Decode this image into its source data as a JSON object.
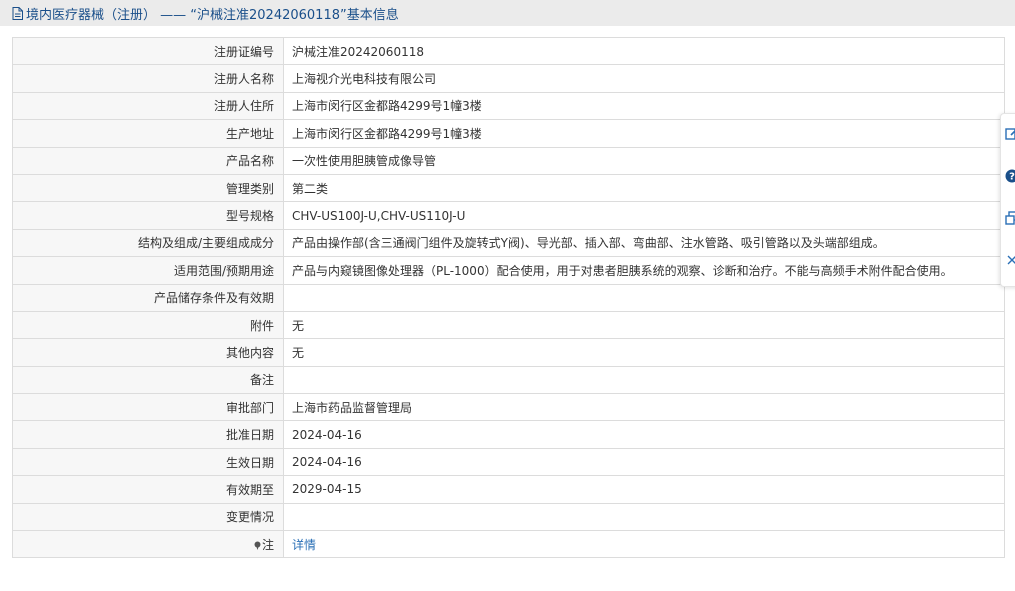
{
  "header": {
    "title": "境内医疗器械（注册） —— “沪械注准20242060118”基本信息",
    "icon": "document-icon"
  },
  "rows": [
    {
      "label": "注册证编号",
      "value": "沪械注准20242060118"
    },
    {
      "label": "注册人名称",
      "value": "上海视介光电科技有限公司"
    },
    {
      "label": "注册人住所",
      "value": "上海市闵行区金都路4299号1幢3楼"
    },
    {
      "label": "生产地址",
      "value": "上海市闵行区金都路4299号1幢3楼"
    },
    {
      "label": "产品名称",
      "value": "一次性使用胆胰管成像导管"
    },
    {
      "label": "管理类别",
      "value": "第二类"
    },
    {
      "label": "型号规格",
      "value": "CHV-US100J-U,CHV-US110J-U"
    },
    {
      "label": "结构及组成/主要组成成分",
      "value": "产品由操作部(含三通阀门组件及旋转式Y阀)、导光部、插入部、弯曲部、注水管路、吸引管路以及头端部组成。"
    },
    {
      "label": "适用范围/预期用途",
      "value": "产品与内窥镜图像处理器（PL-1000）配合使用，用于对患者胆胰系统的观察、诊断和治疗。不能与高频手术附件配合使用。"
    },
    {
      "label": "产品储存条件及有效期",
      "value": ""
    },
    {
      "label": "附件",
      "value": "无"
    },
    {
      "label": "其他内容",
      "value": "无"
    },
    {
      "label": "备注",
      "value": ""
    },
    {
      "label": "审批部门",
      "value": "上海市药品监督管理局"
    },
    {
      "label": "批准日期",
      "value": "2024-04-16"
    },
    {
      "label": "生效日期",
      "value": "2024-04-16"
    },
    {
      "label": "有效期至",
      "value": "2029-04-15"
    },
    {
      "label": "变更情况",
      "value": ""
    }
  ],
  "note_row": {
    "label": "注",
    "link": "详情"
  },
  "sidebar": {
    "items": [
      {
        "icon": "edit-icon"
      },
      {
        "icon": "help-icon"
      },
      {
        "icon": "copy-icon"
      },
      {
        "icon": "close-icon"
      }
    ]
  },
  "colors": {
    "header_bg": "#ebebeb",
    "header_text": "#1a4f8a",
    "link": "#2a6fb6",
    "border": "#dcdcdc"
  }
}
